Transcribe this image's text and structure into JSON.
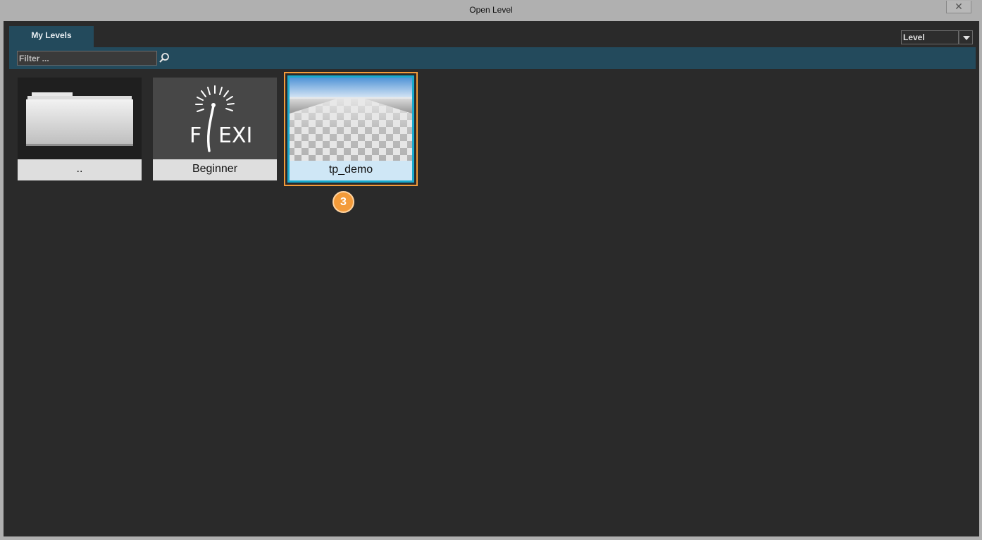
{
  "window": {
    "title": "Open Level",
    "close_symbol": "✕"
  },
  "tabs": [
    {
      "label": "My Levels",
      "active": true
    }
  ],
  "type_filter": {
    "selected": "Level"
  },
  "filter": {
    "placeholder": "Filter ...",
    "value": ""
  },
  "levels": [
    {
      "label": "..",
      "thumbnail": "folder-icon",
      "selected": false
    },
    {
      "label": "Beginner",
      "thumbnail": "flexi-logo",
      "selected": false,
      "logo_text": "FEXI"
    },
    {
      "label": "tp_demo",
      "thumbnail": "checkerboard-preview",
      "selected": true
    }
  ],
  "annotation": {
    "step_number": "3"
  },
  "colors": {
    "accent": "#234a5c",
    "selection_border": "#19aacd",
    "highlight": "#f39b3a",
    "background": "#2a2a2a"
  }
}
